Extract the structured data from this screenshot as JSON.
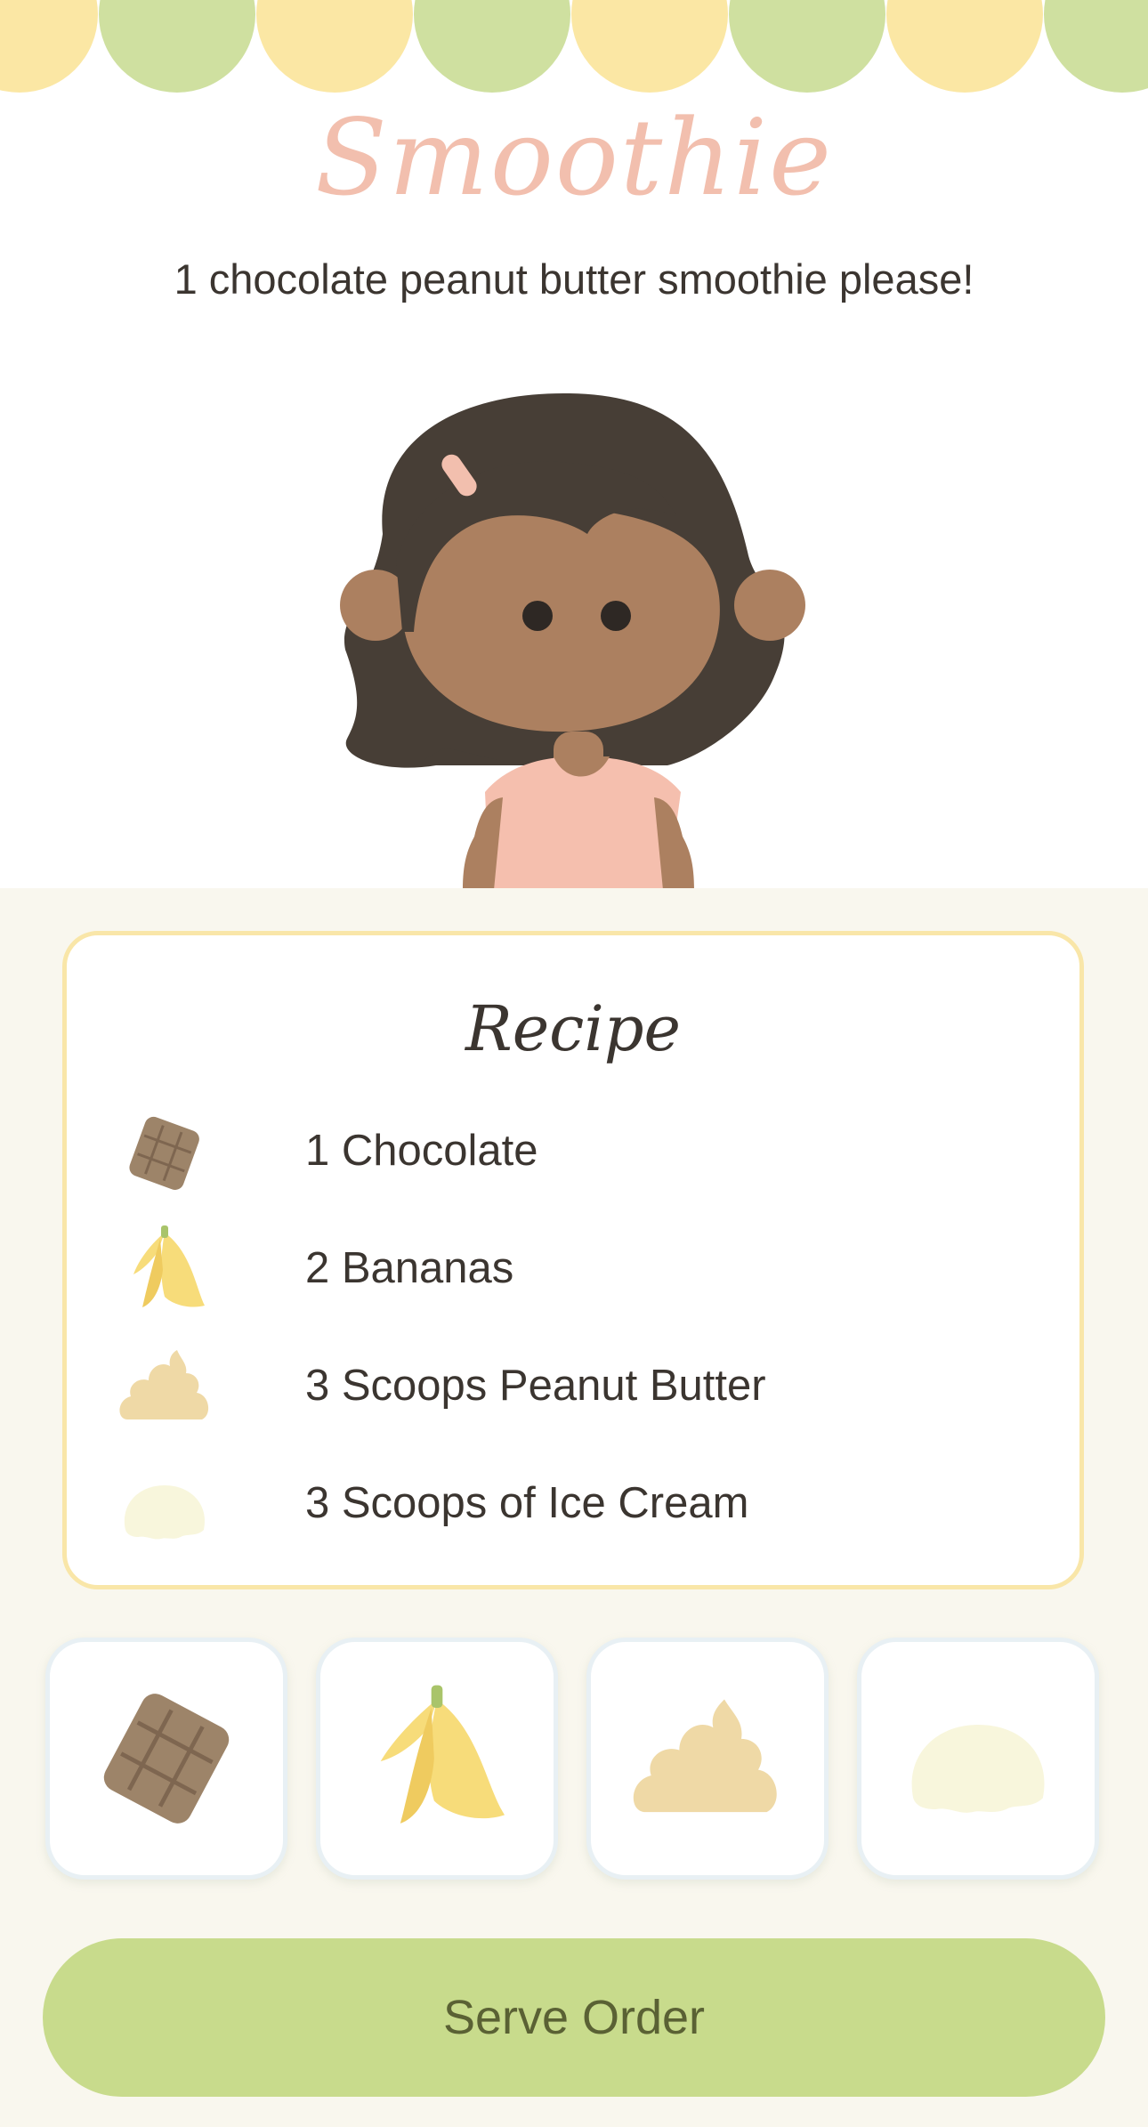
{
  "page": {
    "title": "Smoothie",
    "order_text": "1 chocolate peanut butter smoothie please!"
  },
  "colors": {
    "awning_yellow": "#fbe7a4",
    "awning_green": "#cfe0a0",
    "title_pink": "#f2bfae",
    "button_green": "#c8db8c",
    "panel_border": "#f9e6a8"
  },
  "customer": {
    "icon": "girl-customer-icon"
  },
  "recipe": {
    "title": "Recipe",
    "items": [
      {
        "label": "1 Chocolate",
        "icon": "chocolate-icon"
      },
      {
        "label": "2 Bananas",
        "icon": "banana-icon"
      },
      {
        "label": "3 Scoops Peanut Butter",
        "icon": "peanut-butter-icon"
      },
      {
        "label": "3 Scoops of Ice Cream",
        "icon": "ice-cream-icon"
      }
    ]
  },
  "ingredients": [
    {
      "name": "chocolate",
      "icon": "chocolate-icon"
    },
    {
      "name": "banana",
      "icon": "banana-icon"
    },
    {
      "name": "peanut-butter",
      "icon": "peanut-butter-icon"
    },
    {
      "name": "ice-cream",
      "icon": "ice-cream-icon"
    }
  ],
  "actions": {
    "serve_label": "Serve Order"
  }
}
